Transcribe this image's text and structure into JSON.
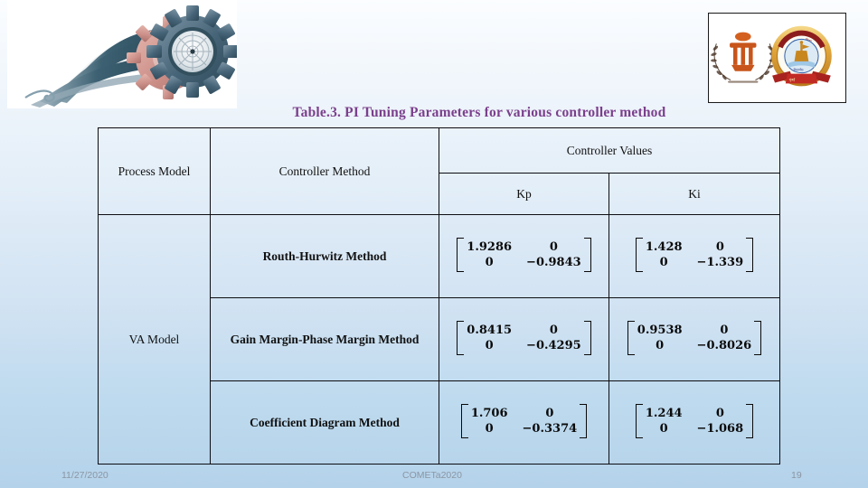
{
  "slide": {
    "title": "Table.3. PI Tuning Parameters for various controller method",
    "title_color": "#7b3f8c",
    "background_top_color": "#fbfdff",
    "background_bottom_color": "#b4d2ea"
  },
  "images": {
    "banner": {
      "name": "gears-and-ribbon-graphic",
      "alt": "Stylized dark teal ribbon flowing into two metallic gears with an ornate clock face"
    },
    "logos": {
      "name": "institution-logos",
      "alt": "Two institutional emblems: a laurel-wreath crest and a circular gold-rimmed university seal with red ribbon"
    }
  },
  "table": {
    "headers": {
      "process_model": "Process Model",
      "controller_method": "Controller Method",
      "controller_values": "Controller Values",
      "kp": "Kp",
      "ki": "Ki"
    },
    "process_model_value": "VA Model",
    "rows": [
      {
        "method": "Routh-Hurwitz Method",
        "kp": [
          "1.9286",
          "0",
          "0",
          "−0.9843"
        ],
        "ki": [
          "1.428",
          "0",
          "0",
          "−1.339"
        ]
      },
      {
        "method": "Gain Margin-Phase Margin Method",
        "kp": [
          "0.8415",
          "0",
          "0",
          "−0.4295"
        ],
        "ki": [
          "0.9538",
          "0",
          "0",
          "−0.8026"
        ]
      },
      {
        "method": "Coefficient Diagram Method",
        "kp": [
          "1.706",
          "0",
          "0",
          "−0.3374"
        ],
        "ki": [
          "1.244",
          "0",
          "0",
          "−1.068"
        ]
      }
    ]
  },
  "footer": {
    "date": "11/27/2020",
    "conference": "COMETa2020",
    "page_number": "19"
  }
}
